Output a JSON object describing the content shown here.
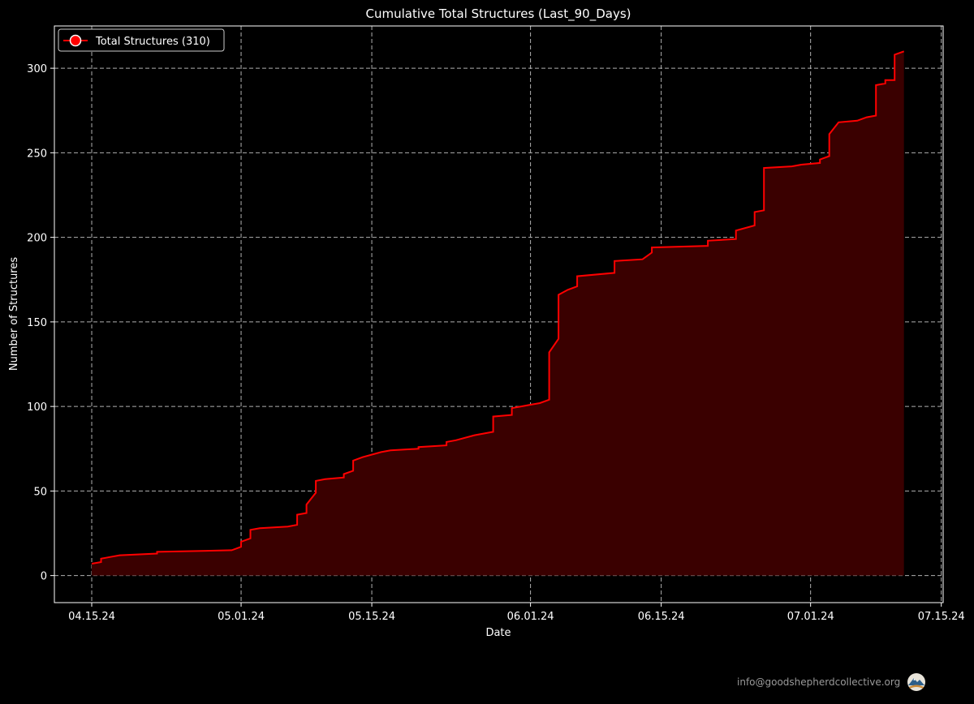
{
  "chart_data": {
    "type": "area",
    "title": "Cumulative Total Structures (Last_90_Days)",
    "xlabel": "Date",
    "ylabel": "Number of Structures",
    "x_ticks": [
      "04.15.24",
      "05.01.24",
      "05.15.24",
      "06.01.24",
      "06.15.24",
      "07.01.24",
      "07.15.24"
    ],
    "y_ticks": [
      0,
      50,
      100,
      150,
      200,
      250,
      300
    ],
    "xlim": [
      "2024-04-11",
      "2024-07-15"
    ],
    "ylim": [
      -16,
      325
    ],
    "grid": true,
    "legend_position": "top-left",
    "series": [
      {
        "name": "Total Structures (310)",
        "color": "#ff0000",
        "fill_color": "#3a0000",
        "points": [
          [
            "2024-04-15",
            7
          ],
          [
            "2024-04-16",
            8
          ],
          [
            "2024-04-16",
            10
          ],
          [
            "2024-04-17",
            11
          ],
          [
            "2024-04-18",
            12
          ],
          [
            "2024-04-22",
            13
          ],
          [
            "2024-04-22",
            14
          ],
          [
            "2024-04-30",
            15
          ],
          [
            "2024-05-01",
            17
          ],
          [
            "2024-05-01",
            20
          ],
          [
            "2024-05-02",
            22
          ],
          [
            "2024-05-02",
            27
          ],
          [
            "2024-05-03",
            28
          ],
          [
            "2024-05-06",
            29
          ],
          [
            "2024-05-07",
            30
          ],
          [
            "2024-05-07",
            36
          ],
          [
            "2024-05-08",
            37
          ],
          [
            "2024-05-08",
            42
          ],
          [
            "2024-05-09",
            49
          ],
          [
            "2024-05-09",
            56
          ],
          [
            "2024-05-10",
            57
          ],
          [
            "2024-05-12",
            58
          ],
          [
            "2024-05-12",
            60
          ],
          [
            "2024-05-13",
            62
          ],
          [
            "2024-05-13",
            68
          ],
          [
            "2024-05-14",
            70
          ],
          [
            "2024-05-16",
            73
          ],
          [
            "2024-05-17",
            74
          ],
          [
            "2024-05-20",
            75
          ],
          [
            "2024-05-20",
            76
          ],
          [
            "2024-05-23",
            77
          ],
          [
            "2024-05-23",
            79
          ],
          [
            "2024-05-24",
            80
          ],
          [
            "2024-05-26",
            83
          ],
          [
            "2024-05-28",
            85
          ],
          [
            "2024-05-28",
            94
          ],
          [
            "2024-05-30",
            95
          ],
          [
            "2024-05-30",
            99
          ],
          [
            "2024-05-31",
            100
          ],
          [
            "2024-06-01",
            101
          ],
          [
            "2024-06-02",
            102
          ],
          [
            "2024-06-03",
            104
          ],
          [
            "2024-06-03",
            132
          ],
          [
            "2024-06-04",
            140
          ],
          [
            "2024-06-04",
            166
          ],
          [
            "2024-06-05",
            169
          ],
          [
            "2024-06-06",
            171
          ],
          [
            "2024-06-06",
            177
          ],
          [
            "2024-06-10",
            179
          ],
          [
            "2024-06-10",
            186
          ],
          [
            "2024-06-13",
            187
          ],
          [
            "2024-06-14",
            191
          ],
          [
            "2024-06-14",
            194
          ],
          [
            "2024-06-20",
            195
          ],
          [
            "2024-06-20",
            198
          ],
          [
            "2024-06-23",
            199
          ],
          [
            "2024-06-23",
            204
          ],
          [
            "2024-06-25",
            207
          ],
          [
            "2024-06-25",
            215
          ],
          [
            "2024-06-26",
            216
          ],
          [
            "2024-06-26",
            241
          ],
          [
            "2024-06-29",
            242
          ],
          [
            "2024-06-30",
            243
          ],
          [
            "2024-07-02",
            244
          ],
          [
            "2024-07-02",
            246
          ],
          [
            "2024-07-03",
            248
          ],
          [
            "2024-07-03",
            261
          ],
          [
            "2024-07-04",
            268
          ],
          [
            "2024-07-06",
            269
          ],
          [
            "2024-07-07",
            271
          ],
          [
            "2024-07-08",
            272
          ],
          [
            "2024-07-08",
            290
          ],
          [
            "2024-07-09",
            291
          ],
          [
            "2024-07-09",
            293
          ],
          [
            "2024-07-10",
            293
          ],
          [
            "2024-07-10",
            308
          ],
          [
            "2024-07-11",
            310
          ]
        ]
      }
    ]
  },
  "footer": {
    "email": "info@goodshepherdcollective.org"
  },
  "logo": {
    "icon": "mountain-globe-logo-icon"
  }
}
